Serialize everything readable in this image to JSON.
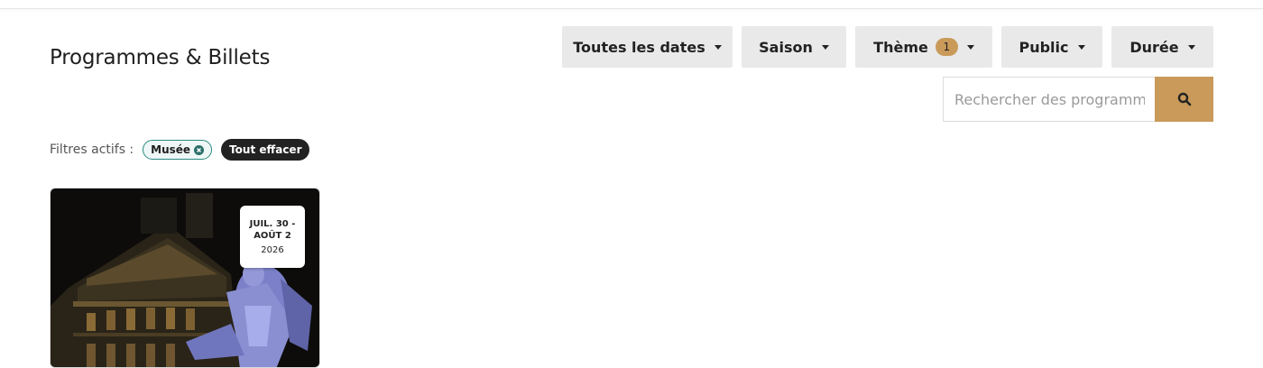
{
  "header": {
    "title": "Programmes & Billets"
  },
  "filters": {
    "dates_label": "Toutes les dates",
    "season_label": "Saison",
    "theme_label": "Thème",
    "theme_count": "1",
    "audience_label": "Public",
    "duration_label": "Durée"
  },
  "search": {
    "placeholder": "Rechercher des programmes",
    "value": ""
  },
  "active_filters": {
    "label": "Filtres actifs :",
    "chips": [
      "Musée"
    ],
    "clear_label": "Tout effacer"
  },
  "cards": [
    {
      "date_range": "JUIL. 30 - AOÛT 2",
      "year": "2026",
      "image_subject": "equestrian-statue-at-night"
    }
  ],
  "colors": {
    "accent": "#c99a5a",
    "chip_border": "#2a8a82",
    "dark": "#222222",
    "button_bg": "#e9e9e9"
  },
  "icons": {
    "search": "search-icon",
    "caret": "caret-down-icon",
    "remove": "close-circle-icon"
  }
}
